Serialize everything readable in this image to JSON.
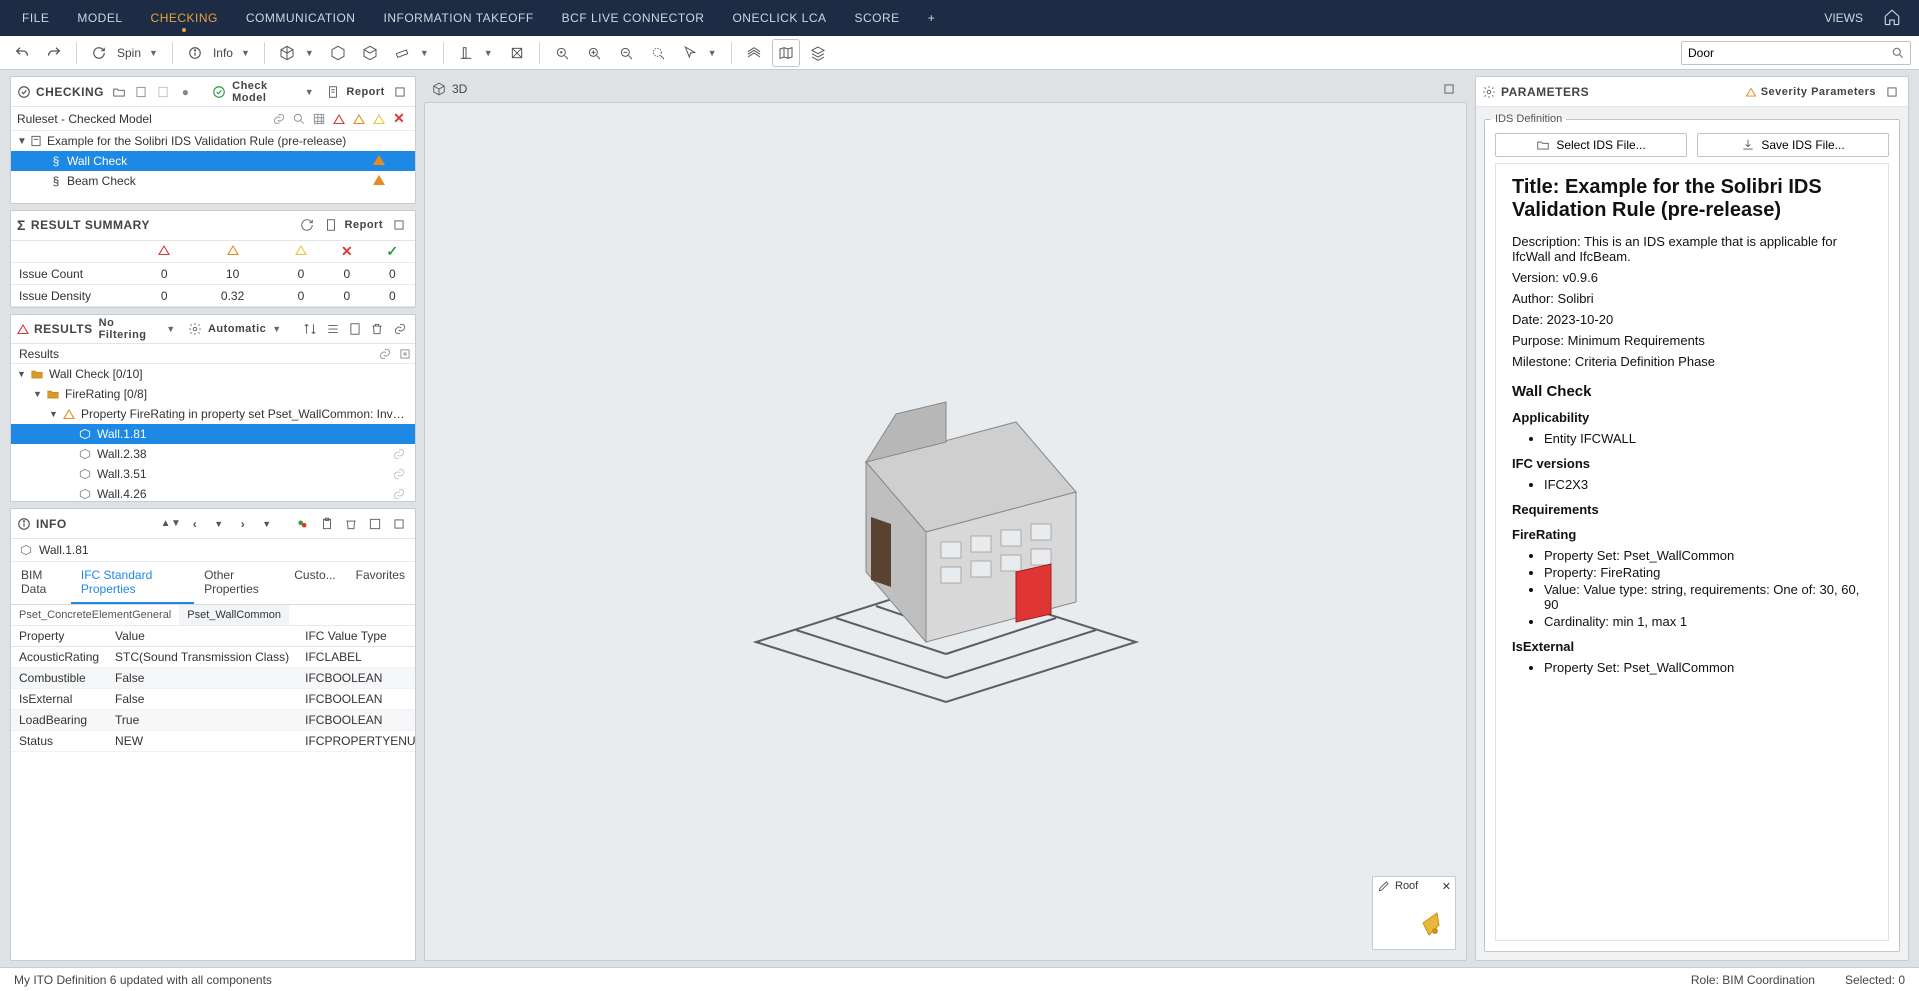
{
  "menubar": {
    "items": [
      "FILE",
      "MODEL",
      "CHECKING",
      "COMMUNICATION",
      "INFORMATION TAKEOFF",
      "BCF LIVE CONNECTOR",
      "ONECLICK LCA",
      "SCORE"
    ],
    "active_index": 2,
    "views_label": "VIEWS"
  },
  "toolbar": {
    "spin_label": "Spin",
    "info_label": "Info",
    "search_value": "Door"
  },
  "checking_panel": {
    "title": "CHECKING",
    "check_model_btn": "Check Model",
    "report_btn": "Report",
    "ruleset_label": "Ruleset - Checked Model",
    "root": "Example for the Solibri IDS Validation Rule (pre-release)",
    "rules": [
      "Wall Check",
      "Beam Check"
    ],
    "selected_index": 0
  },
  "result_summary": {
    "title": "RESULT SUMMARY",
    "report_btn": "Report",
    "rows": [
      {
        "label": "Issue Count",
        "cells": [
          "0",
          "10",
          "0",
          "0",
          "0"
        ]
      },
      {
        "label": "Issue Density",
        "cells": [
          "0",
          "0.32",
          "0",
          "0",
          "0"
        ]
      }
    ]
  },
  "results_panel": {
    "title": "RESULTS",
    "filter_label": "No Filtering",
    "auto_label": "Automatic",
    "results_label": "Results",
    "tree": {
      "root": "Wall Check [0/10]",
      "group": "FireRating [0/8]",
      "issue": "Property FireRating in property set Pset_WallCommon: Invalid Cardinality",
      "items": [
        "Wall.1.81",
        "Wall.2.38",
        "Wall.3.51",
        "Wall.4.26"
      ],
      "selected_index": 0
    }
  },
  "info_panel": {
    "title": "INFO",
    "component": "Wall.1.81",
    "tabs": [
      "BIM Data",
      "IFC Standard Properties",
      "Other Properties",
      "Custo...",
      "Favorites"
    ],
    "active_tab": 1,
    "pset_tabs": [
      "Pset_ConcreteElementGeneral",
      "Pset_WallCommon"
    ],
    "active_pset": 1,
    "columns": [
      "Property",
      "Value",
      "IFC Value Type"
    ],
    "rows": [
      {
        "p": "AcousticRating",
        "v": "STC(Sound Transmission Class)",
        "t": "IFCLABEL"
      },
      {
        "p": "Combustible",
        "v": "False",
        "t": "IFCBOOLEAN"
      },
      {
        "p": "IsExternal",
        "v": "False",
        "t": "IFCBOOLEAN"
      },
      {
        "p": "LoadBearing",
        "v": "True",
        "t": "IFCBOOLEAN"
      },
      {
        "p": "Status",
        "v": "NEW",
        "t": "IFCPROPERTYENUMERATEDV..."
      }
    ]
  },
  "view3d": {
    "label": "3D",
    "roof_label": "Roof"
  },
  "parameters_panel": {
    "title": "PARAMETERS",
    "severity_label": "Severity Parameters",
    "legend": "IDS Definition",
    "select_btn": "Select IDS File...",
    "save_btn": "Save IDS File...",
    "doc": {
      "title": "Title: Example for the Solibri IDS Validation Rule (pre-release)",
      "description": "Description: This is an IDS example that is applicable for IfcWall and IfcBeam.",
      "version": "Version: v0.9.6",
      "author": "Author: Solibri",
      "date": "Date: 2023-10-20",
      "purpose": "Purpose: Minimum Requirements",
      "milestone": "Milestone: Criteria Definition Phase",
      "h_wallcheck": "Wall Check",
      "h_applicability": "Applicability",
      "li_entity": "Entity IFCWALL",
      "h_ifcversions": "IFC versions",
      "li_ifc2x3": "IFC2X3",
      "h_requirements": "Requirements",
      "h_firerating": "FireRating",
      "fr_items": [
        "Property Set: Pset_WallCommon",
        "Property: FireRating",
        "Value: Value type: string, requirements: One of: 30, 60, 90",
        "Cardinality: min 1, max 1"
      ],
      "h_isexternal": "IsExternal",
      "ie_items": [
        "Property Set: Pset_WallCommon"
      ]
    }
  },
  "statusbar": {
    "message": "My ITO Definition 6 updated with all components",
    "role": "Role: BIM Coordination",
    "selected": "Selected: 0"
  }
}
